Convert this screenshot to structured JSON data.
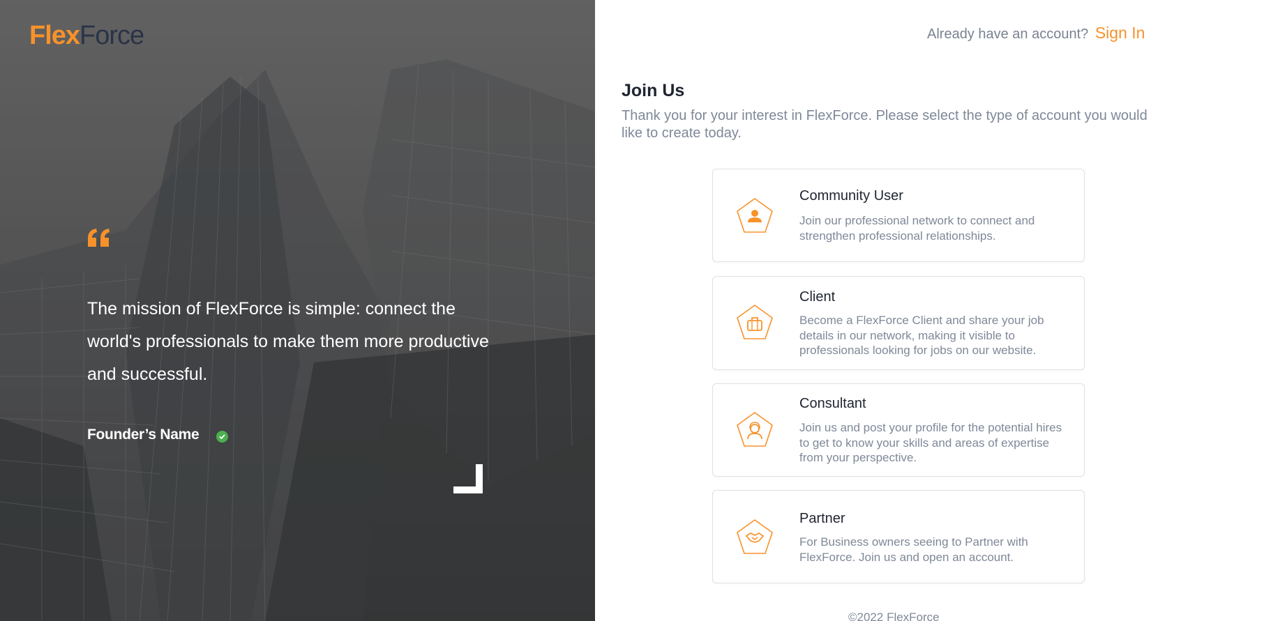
{
  "brand": {
    "logo_part1": "Flex",
    "logo_part2": "Force",
    "accent": "#f7922b",
    "dark": "#2a3347"
  },
  "hero": {
    "quote_icon": "quote-icon",
    "quote": "The mission of FlexForce is simple: connect the world's professionals to make them more productive and successful.",
    "founder": "Founder’s Name",
    "verified_icon": "check-circle-icon"
  },
  "header": {
    "prompt": "Already have an account?",
    "signin_label": "Sign In"
  },
  "join": {
    "title": "Join Us",
    "description": "Thank you for your interest in FlexForce. Please select the type of account you would like to create today."
  },
  "account_types": [
    {
      "icon": "user-icon",
      "title": "Community User",
      "description": "Join our professional network to connect and strengthen professional relationships."
    },
    {
      "icon": "briefcase-icon",
      "title": "Client",
      "description": "Become a FlexForce Client and share your job details in our network, making it visible to professionals looking for jobs on our website."
    },
    {
      "icon": "consultant-icon",
      "title": "Consultant",
      "description": "Join us and post your profile for the potential hires to get to know your skills and areas of expertise from your perspective."
    },
    {
      "icon": "handshake-icon",
      "title": "Partner",
      "description": "For Business owners seeing to Partner with FlexForce. Join us and open an account."
    }
  ],
  "footer": {
    "copyright": "©2022 FlexForce"
  }
}
